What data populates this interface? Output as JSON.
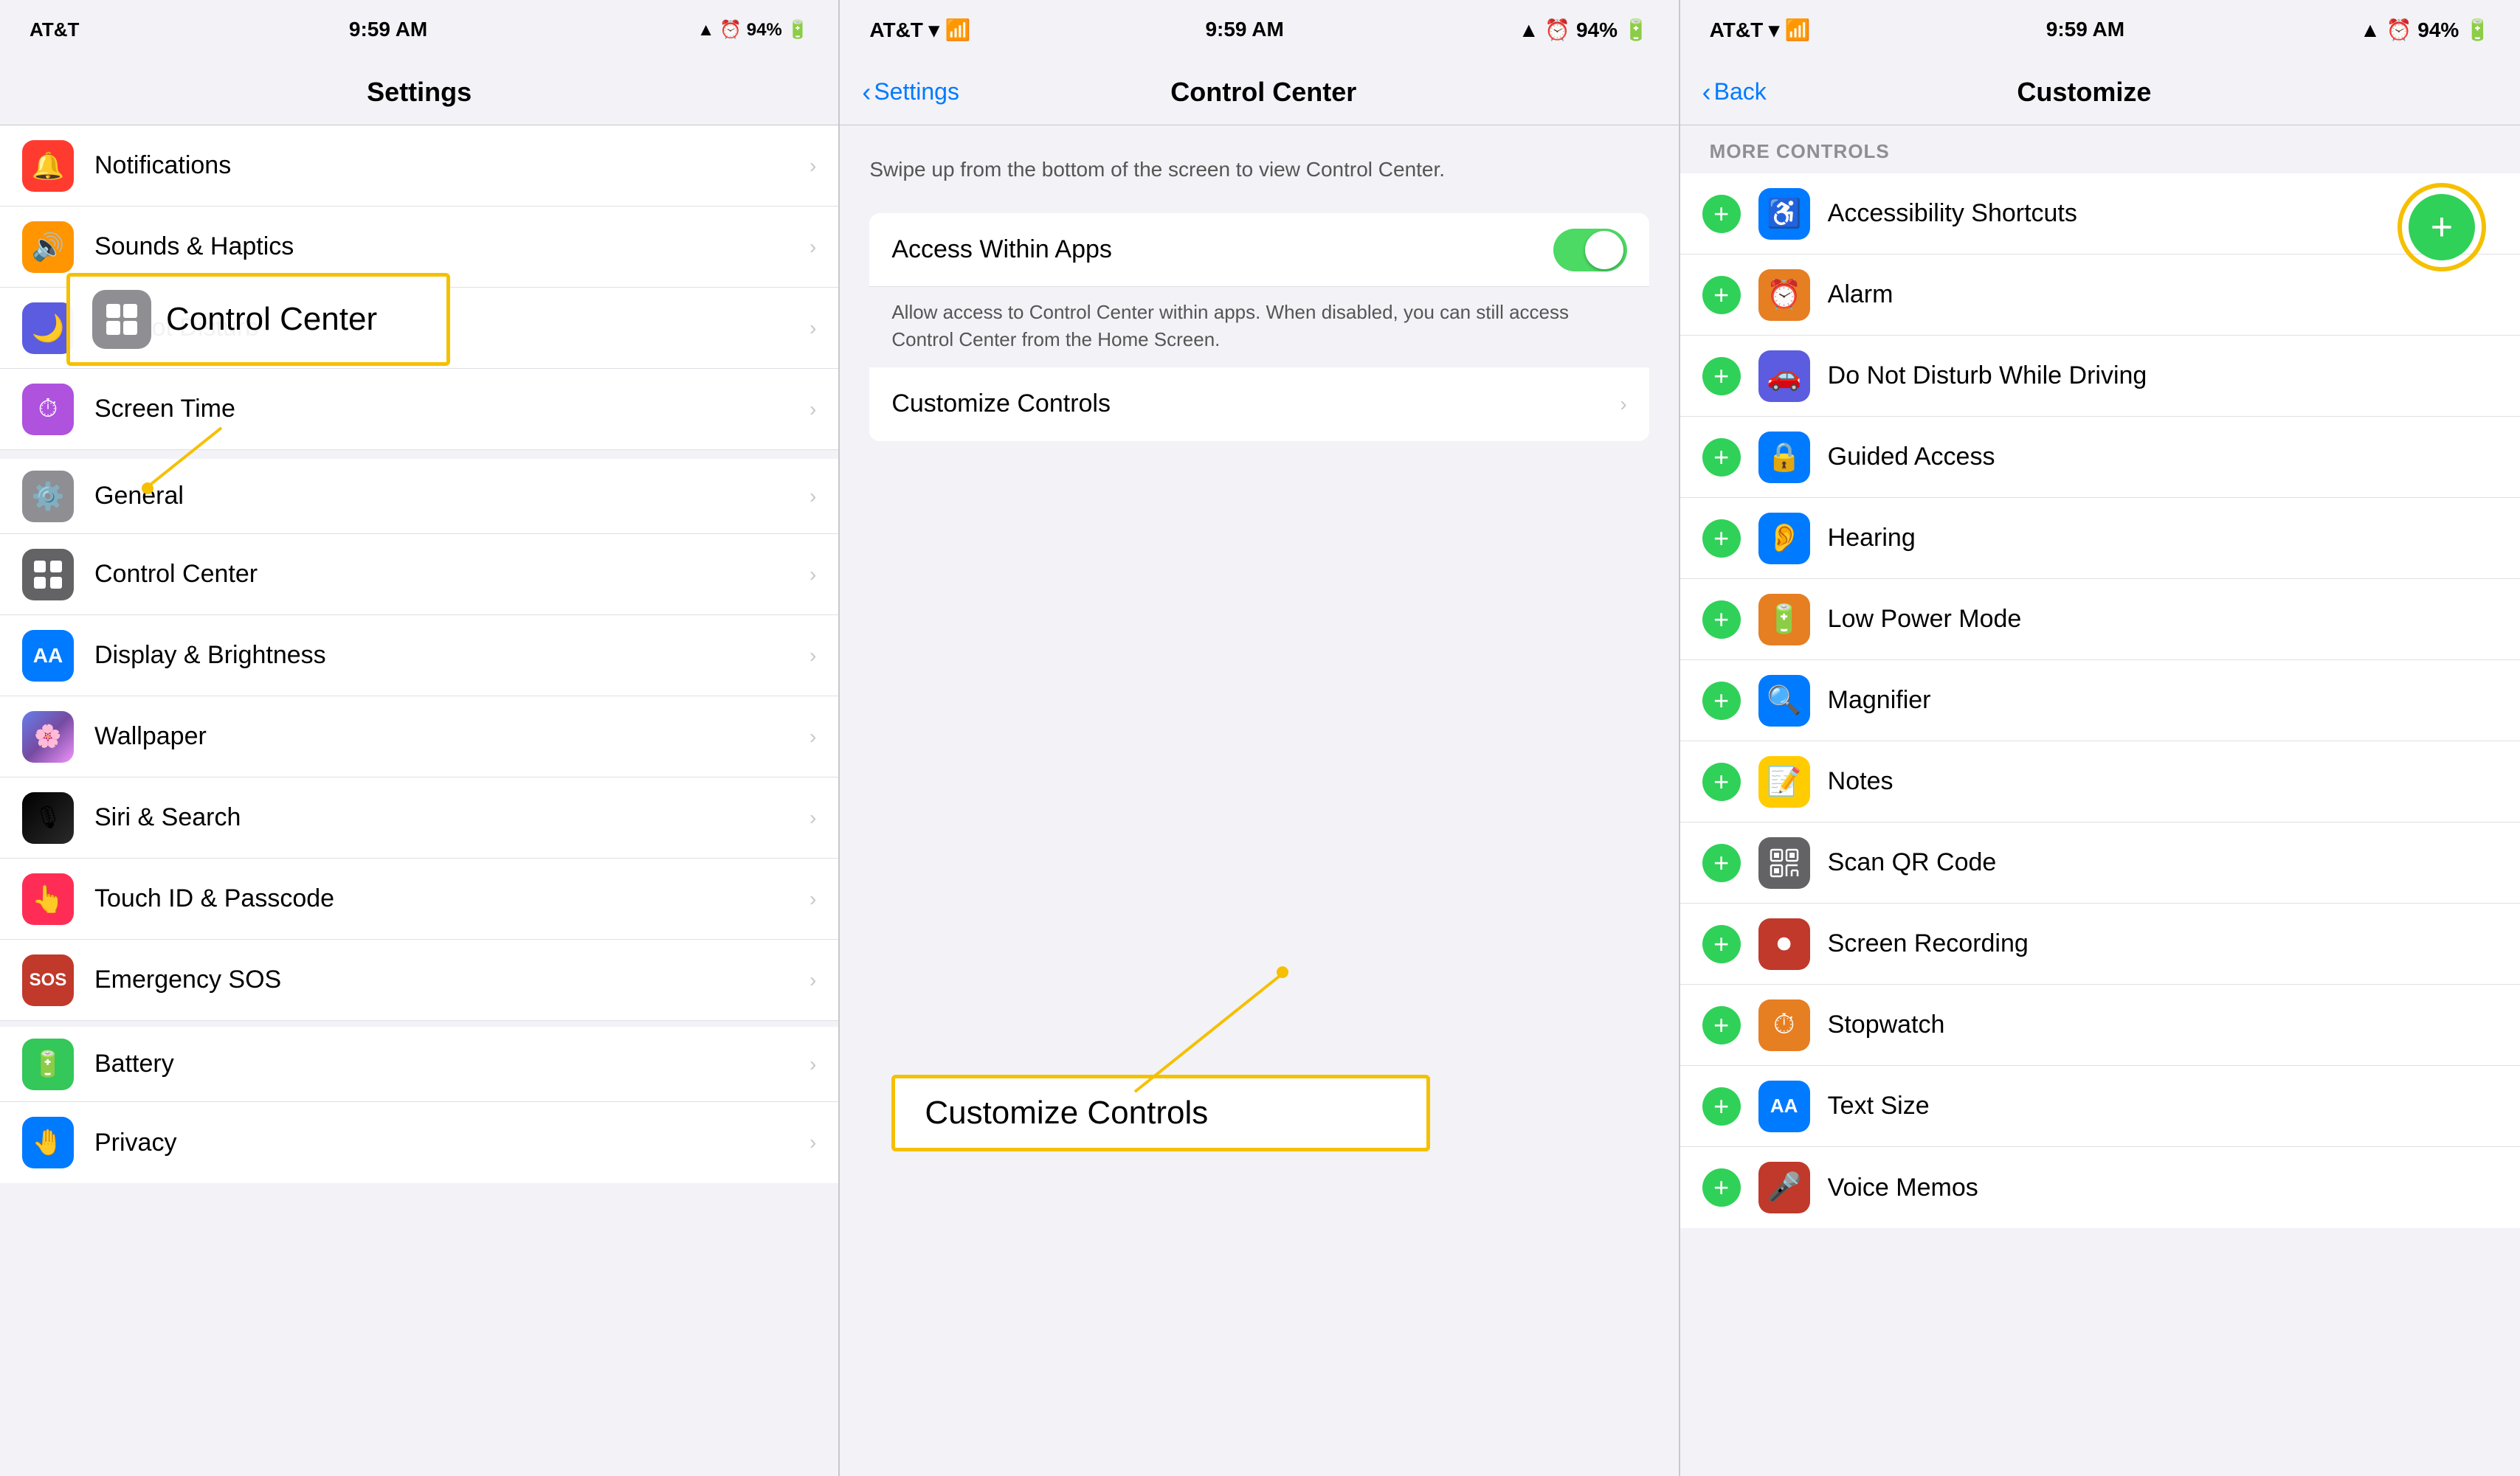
{
  "panel1": {
    "status": {
      "carrier": "AT&T",
      "wifi": "wifi",
      "time": "9:59 AM",
      "location": "▲",
      "alarm": "⏰",
      "battery": "94%"
    },
    "nav_title": "Settings",
    "highlight_label": "Control Center",
    "rows": [
      {
        "id": "notifications",
        "label": "Notifications",
        "icon_color": "ic-red",
        "icon": "🔔"
      },
      {
        "id": "sounds",
        "label": "Sounds & Haptics",
        "icon_color": "ic-orange",
        "icon": "🔊"
      },
      {
        "id": "do-not-disturb",
        "label": "Do Not Disturb",
        "icon_color": "ic-indigo",
        "icon": "🌙"
      },
      {
        "id": "screen-time",
        "label": "Screen Time",
        "icon_color": "ic-purple",
        "icon": "⏱"
      },
      {
        "id": "general",
        "label": "General",
        "icon_color": "ic-gray",
        "icon": "⚙️"
      },
      {
        "id": "control-center",
        "label": "Control Center",
        "icon_color": "ic-dark-gray",
        "icon": "⊞"
      },
      {
        "id": "display",
        "label": "Display & Brightness",
        "icon_color": "ic-blue",
        "icon": "AA"
      },
      {
        "id": "wallpaper",
        "label": "Wallpaper",
        "icon_color": "ic-teal",
        "icon": "✦"
      },
      {
        "id": "siri",
        "label": "Siri & Search",
        "icon_color": "ic-dark-gray",
        "icon": "◎"
      },
      {
        "id": "touch-id",
        "label": "Touch ID & Passcode",
        "icon_color": "ic-pink",
        "icon": "👆"
      },
      {
        "id": "emergency-sos",
        "label": "Emergency SOS",
        "icon_color": "ic-dark-red",
        "icon": "SOS"
      },
      {
        "id": "battery",
        "label": "Battery",
        "icon_color": "ic-green",
        "icon": "🔋"
      },
      {
        "id": "privacy",
        "label": "Privacy",
        "icon_color": "ic-blue",
        "icon": "🤚"
      }
    ]
  },
  "panel2": {
    "status": {
      "carrier": "AT&T",
      "wifi": "wifi",
      "time": "9:59 AM",
      "location": "▲",
      "alarm": "⏰",
      "battery": "94%"
    },
    "nav_back": "Settings",
    "nav_title": "Control Center",
    "description": "Swipe up from the bottom of the screen to view Control Center.",
    "rows": [
      {
        "id": "access-within-apps",
        "label": "Access Within Apps",
        "has_toggle": true,
        "toggle_on": true
      },
      {
        "id": "customize-controls",
        "label": "Customize Controls",
        "has_chevron": true
      }
    ],
    "toggle_description": "Allow access to Control Center within apps. When disabled, you can still access Control Center from the Home Screen.",
    "highlight_label": "Customize Controls"
  },
  "panel3": {
    "status": {
      "carrier": "AT&T",
      "wifi": "wifi",
      "time": "9:59 AM",
      "location": "▲",
      "alarm": "⏰",
      "battery": "94%"
    },
    "nav_back": "Back",
    "nav_title": "Customize",
    "section_header": "MORE CONTROLS",
    "items": [
      {
        "id": "accessibility-shortcuts",
        "label": "Accessibility Shortcuts",
        "icon_color": "ic-blue",
        "icon": "♿"
      },
      {
        "id": "alarm",
        "label": "Alarm",
        "icon_color": "ic-dark-orange",
        "icon": "⏰"
      },
      {
        "id": "do-not-disturb-driving",
        "label": "Do Not Disturb While Driving",
        "icon_color": "ic-indigo",
        "icon": "🚗"
      },
      {
        "id": "guided-access",
        "label": "Guided Access",
        "icon_color": "ic-blue",
        "icon": "🔒"
      },
      {
        "id": "hearing",
        "label": "Hearing",
        "icon_color": "ic-blue",
        "icon": "👂"
      },
      {
        "id": "low-power-mode",
        "label": "Low Power Mode",
        "icon_color": "ic-dark-orange",
        "icon": "🔋"
      },
      {
        "id": "magnifier",
        "label": "Magnifier",
        "icon_color": "ic-blue",
        "icon": "🔍"
      },
      {
        "id": "notes",
        "label": "Notes",
        "icon_color": "ic-yellow",
        "icon": "📝"
      },
      {
        "id": "scan-qr-code",
        "label": "Scan QR Code",
        "icon_color": "ic-dark-gray",
        "icon": "⊞"
      },
      {
        "id": "screen-recording",
        "label": "Screen Recording",
        "icon_color": "ic-dark-red",
        "icon": "⏺"
      },
      {
        "id": "stopwatch",
        "label": "Stopwatch",
        "icon_color": "ic-dark-orange",
        "icon": "⏱"
      },
      {
        "id": "text-size",
        "label": "Text Size",
        "icon_color": "ic-blue",
        "icon": "AA"
      },
      {
        "id": "voice-memos",
        "label": "Voice Memos",
        "icon_color": "ic-dark-red",
        "icon": "🎤"
      }
    ],
    "add_button_label": "+"
  }
}
